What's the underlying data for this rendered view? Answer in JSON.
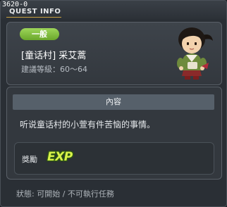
{
  "window": {
    "quest_id": "3620-0",
    "heading": "QUEST INFO"
  },
  "quest": {
    "category": "一般",
    "title": "[童话村] 采艾蒿",
    "level_label": "建議等級：60～64"
  },
  "content": {
    "header": "內容",
    "text": "听说童话村的小萱有件苦恼的事情。"
  },
  "reward": {
    "label": "獎勵",
    "exp_icon": "exp-icon",
    "exp_text": "EXP"
  },
  "status": "狀態: 可開始 / 不可執行任務",
  "colors": {
    "category_pill": "#7dbd3b",
    "exp": "#d9f24a",
    "background": "#2a2f35"
  }
}
